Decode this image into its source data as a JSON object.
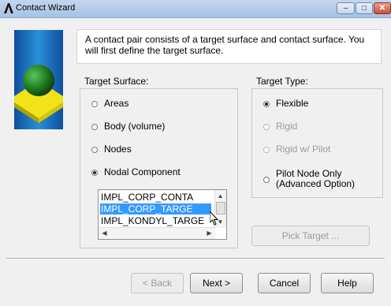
{
  "window": {
    "title": "Contact Wizard",
    "controls": {
      "minimize": "–",
      "maximize": "□",
      "close": "✕"
    }
  },
  "instruction": "A contact pair consists of a target surface and contact surface. You will first define the target surface.",
  "target_surface": {
    "label": "Target Surface:",
    "options": [
      {
        "label": "Areas",
        "selected": false
      },
      {
        "label": "Body (volume)",
        "selected": false
      },
      {
        "label": "Nodes",
        "selected": false
      },
      {
        "label": "Nodal Component",
        "selected": true
      }
    ],
    "components": [
      {
        "label": "IMPL_CORP_CONTA",
        "selected": false
      },
      {
        "label": "IMPL_CORP_TARGE",
        "selected": true
      },
      {
        "label": "IMPL_KONDYL_TARGE",
        "selected": false
      }
    ]
  },
  "target_type": {
    "label": "Target Type:",
    "options": [
      {
        "label": "Flexible",
        "selected": true,
        "enabled": true
      },
      {
        "label": "Rigid",
        "selected": false,
        "enabled": false
      },
      {
        "label": "Rigid w/ Pilot",
        "selected": false,
        "enabled": false
      },
      {
        "label": "Pilot Node Only (Advanced Option)",
        "selected": false,
        "enabled": true
      }
    ]
  },
  "pick_target_label": "Pick Target ...",
  "buttons": {
    "back": "< Back",
    "next": "Next >",
    "cancel": "Cancel",
    "help": "Help"
  },
  "colors": {
    "selection": "#3399ff",
    "logo_blue": "#2a8fd6",
    "sphere_green": "#1f7a1f",
    "plate_yellow": "#f2e21a"
  }
}
